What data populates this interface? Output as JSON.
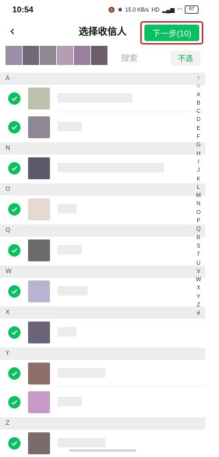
{
  "status_bar": {
    "time": "10:54",
    "battery": "67",
    "network_speed": "15.0 KB/s"
  },
  "header": {
    "title": "选择收信人",
    "next_button": "下一步(10)"
  },
  "search": {
    "placeholder": "搜索",
    "deselect_label": "不选"
  },
  "selected_avatars": [
    "#9a8fa6",
    "#6f6a75",
    "#8d8a93",
    "#b59db4",
    "#9a7fa0",
    "#6c5f68"
  ],
  "sections": [
    {
      "letter": "A",
      "rows": [
        {
          "avatar_color": "#bcc2ae",
          "name_width": 110
        },
        {
          "avatar_color": "#8e8894",
          "name_width": 36
        }
      ]
    },
    {
      "letter": "N",
      "rows": [
        {
          "avatar_color": "#5a5a6a",
          "name_width": 156
        }
      ]
    },
    {
      "letter": "O",
      "rows": [
        {
          "avatar_color": "#e7d9d2",
          "name_width": 28
        }
      ]
    },
    {
      "letter": "Q",
      "rows": [
        {
          "avatar_color": "#6b6b6b",
          "name_width": 36
        }
      ]
    },
    {
      "letter": "W",
      "rows": [
        {
          "avatar_color": "#b9b3d1",
          "name_width": 44
        }
      ]
    },
    {
      "letter": "X",
      "rows": [
        {
          "avatar_color": "#6b6478",
          "name_width": 28
        }
      ]
    },
    {
      "letter": "Y",
      "rows": [
        {
          "avatar_color": "#8c6f6a",
          "name_width": 70
        },
        {
          "avatar_color": "#c59ac8",
          "name_width": 36
        }
      ]
    },
    {
      "letter": "Z",
      "rows": [
        {
          "avatar_color": "#7a6a6a",
          "name_width": 70
        }
      ]
    }
  ],
  "alpha_index": [
    "↑",
    "☆",
    "A",
    "B",
    "C",
    "D",
    "E",
    "F",
    "G",
    "H",
    "I",
    "J",
    "K",
    "L",
    "M",
    "N",
    "O",
    "P",
    "Q",
    "R",
    "S",
    "T",
    "U",
    "V",
    "W",
    "X",
    "Y",
    "Z",
    "#"
  ]
}
